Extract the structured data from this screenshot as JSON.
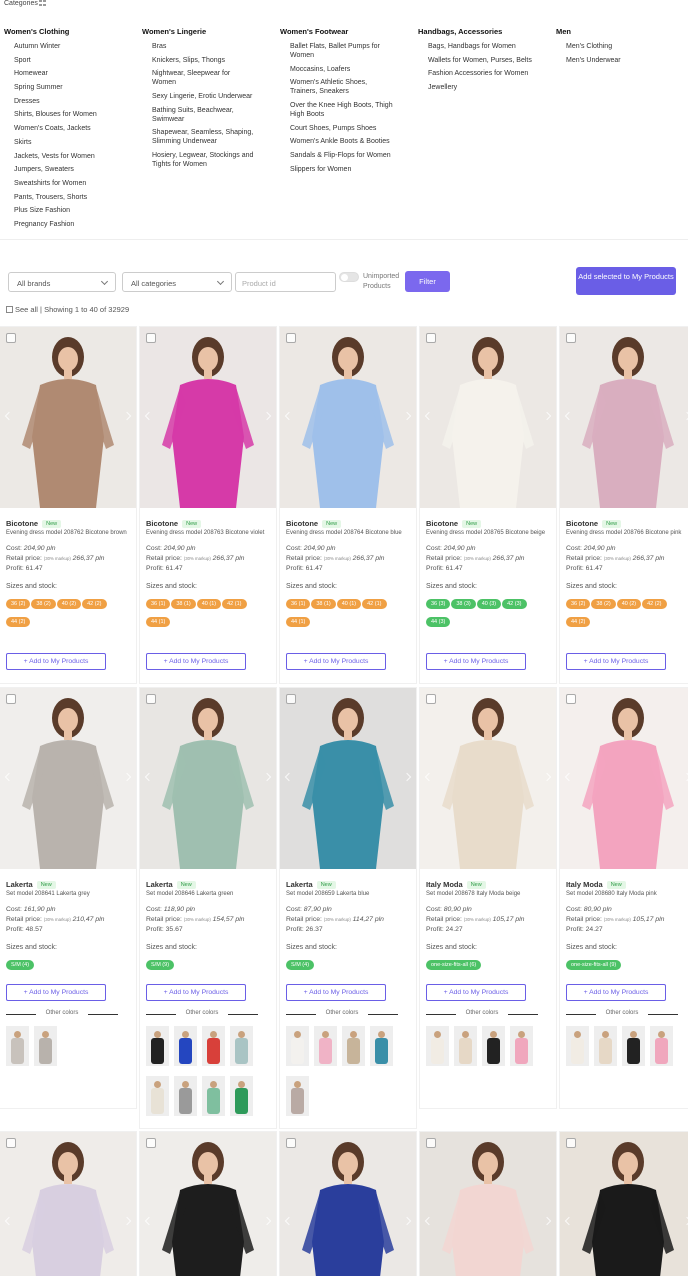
{
  "categories_label": "Categories",
  "mega_menu": [
    {
      "title": "Women's Clothing",
      "items": [
        "Autumn Winter",
        "Sport",
        "Homewear",
        "Spring Summer",
        "Dresses",
        "Shirts, Blouses for Women",
        "Women's Coats, Jackets",
        "Skirts",
        "Jackets, Vests for Women",
        "Jumpers, Sweaters",
        "Sweatshirts for Women",
        "Pants, Trousers, Shorts",
        "Plus Size Fashion",
        "Pregnancy Fashion"
      ]
    },
    {
      "title": "Women's Lingerie",
      "items": [
        "Bras",
        "Knickers, Slips, Thongs",
        "Nightwear, Sleepwear for Women",
        "Sexy Lingerie, Erotic Underwear",
        "Bathing Suits, Beachwear, Swimwear",
        "Shapewear, Seamless, Shaping, Slimming Underwear",
        "Hosiery, Legwear, Stockings and Tights for Women"
      ]
    },
    {
      "title": "Women's Footwear",
      "items": [
        "Ballet Flats, Ballet Pumps for Women",
        "Moccasins, Loafers",
        "Women's Athletic Shoes, Trainers, Sneakers",
        "Over the Knee High Boots, Thigh High Boots",
        "Court Shoes, Pumps Shoes",
        "Women's Ankle Boots & Booties",
        "Sandals & Flip-Flops for Women",
        "Slippers for Women"
      ]
    },
    {
      "title": "Handbags, Accessories",
      "items": [
        "Bags, Handbags for Women",
        "Wallets for Women, Purses, Belts",
        "Fashion Accessories for Women",
        "Jewellery"
      ]
    },
    {
      "title": "Men",
      "items": [
        "Men's Clothing",
        "Men's Underwear"
      ]
    }
  ],
  "filters": {
    "brands": "All brands",
    "categories": "All categories",
    "product_id_placeholder": "Product id",
    "unimported_label": "Unimported Products",
    "filter_button": "Filter",
    "add_selected_button": "Add selected to My Products"
  },
  "listing": {
    "see_all": "See all",
    "showing": "| Showing 1 to 40 of 32929"
  },
  "labels": {
    "new": "New",
    "cost": "Cost:",
    "retail": "Retail price:",
    "markup": "(30% markup)",
    "profit": "Profit:",
    "sizes": "Sizes and stock:",
    "add": "+ Add to My Products",
    "other_colors": "Other colors"
  },
  "products": [
    {
      "brand": "Bicotone",
      "title": "Evening dress model 208762 Bicotone brown",
      "cost": "204,90 pln",
      "retail": "266,37 pln",
      "profit": "61.47",
      "sizes": [
        "36 (2)",
        "38 (2)",
        "40 (2)",
        "42 (2)",
        "44 (2)"
      ],
      "chip_color": "orange",
      "color": "#b08a72",
      "bg": "#ece9e5",
      "thumbs": []
    },
    {
      "brand": "Bicotone",
      "title": "Evening dress model 208763 Bicotone violet",
      "cost": "204,90 pln",
      "retail": "266,37 pln",
      "profit": "61.47",
      "sizes": [
        "36 (1)",
        "38 (1)",
        "40 (1)",
        "42 (1)",
        "44 (1)"
      ],
      "chip_color": "orange",
      "color": "#d63aa8",
      "bg": "#ebe6e5",
      "thumbs": []
    },
    {
      "brand": "Bicotone",
      "title": "Evening dress model 208764 Bicotone blue",
      "cost": "204,90 pln",
      "retail": "266,37 pln",
      "profit": "61.47",
      "sizes": [
        "36 (1)",
        "38 (1)",
        "40 (1)",
        "42 (1)",
        "44 (1)"
      ],
      "chip_color": "orange",
      "color": "#9fc0ea",
      "bg": "#ece8e4",
      "thumbs": []
    },
    {
      "brand": "Bicotone",
      "title": "Evening dress model 208765 Bicotone beige",
      "cost": "204,90 pln",
      "retail": "266,37 pln",
      "profit": "61.47",
      "sizes": [
        "36 (3)",
        "38 (3)",
        "40 (3)",
        "42 (3)",
        "44 (3)"
      ],
      "chip_color": "green",
      "color": "#f5f2ec",
      "bg": "#ece8e4",
      "thumbs": []
    },
    {
      "brand": "Bicotone",
      "title": "Evening dress model 208766 Bicotone pink",
      "cost": "204,90 pln",
      "retail": "266,37 pln",
      "profit": "61.47",
      "sizes": [
        "36 (2)",
        "38 (2)",
        "40 (2)",
        "42 (2)",
        "44 (2)"
      ],
      "chip_color": "orange",
      "color": "#d9aebf",
      "bg": "#ece8e5",
      "thumbs": []
    },
    {
      "brand": "Lakerta",
      "title": "Set model 208641 Lakerta grey",
      "cost": "161,90 pln",
      "retail": "210,47 pln",
      "profit": "48.57",
      "sizes": [
        "S/M (4)"
      ],
      "chip_color": "green",
      "color": "#b9b3ad",
      "bg": "#f0eeec",
      "thumbs": [
        "#c8c2bc",
        "#b8b2ac"
      ]
    },
    {
      "brand": "Lakerta",
      "title": "Set model 208646 Lakerta green",
      "cost": "118,90 pln",
      "retail": "154,57 pln",
      "profit": "35.67",
      "sizes": [
        "S/M (9)"
      ],
      "chip_color": "green",
      "color": "#9fbfb0",
      "bg": "#e8e6e3",
      "thumbs": [
        "#222",
        "#2446c0",
        "#d8403a",
        "#a9c4c4",
        "#e8e2d6",
        "#9a9a9a",
        "#7fbf9f",
        "#2e9a5a"
      ]
    },
    {
      "brand": "Lakerta",
      "title": "Set model 208659 Lakerta blue",
      "cost": "87,90 pln",
      "retail": "114,27 pln",
      "profit": "26.37",
      "sizes": [
        "S/M (4)"
      ],
      "chip_color": "green",
      "color": "#3a8fa8",
      "bg": "#dfdedd",
      "thumbs": [
        "#f3f1ee",
        "#f0b3c6",
        "#c7b49a",
        "#3a8fa8",
        "#b9aaa4"
      ]
    },
    {
      "brand": "Italy Moda",
      "title": "Set model 208678 Italy Moda beige",
      "cost": "80,90 pln",
      "retail": "105,17 pln",
      "profit": "24.27",
      "sizes": [
        "one-size-fits-all (6)"
      ],
      "chip_color": "green",
      "color": "#e8dccb",
      "bg": "#f3f0ec",
      "thumbs": [
        "#f1ece4",
        "#e6d8c6",
        "#222",
        "#f0a7bd"
      ]
    },
    {
      "brand": "Italy Moda",
      "title": "Set model 208680 Italy Moda pink",
      "cost": "80,90 pln",
      "retail": "105,17 pln",
      "profit": "24.27",
      "sizes": [
        "one-size-fits-all (9)"
      ],
      "chip_color": "green",
      "color": "#f3a4bf",
      "bg": "#f4efed",
      "thumbs": [
        "#f1ece4",
        "#e6d8c6",
        "#222",
        "#f0a7bd"
      ]
    },
    {
      "brand": "",
      "title": "",
      "cost": "",
      "retail": "",
      "profit": "",
      "sizes": [],
      "chip_color": "green",
      "color": "#d8cfe0",
      "bg": "#efece9",
      "thumbs": []
    },
    {
      "brand": "",
      "title": "",
      "cost": "",
      "retail": "",
      "profit": "",
      "sizes": [],
      "chip_color": "green",
      "color": "#1d1d1d",
      "bg": "#efedea",
      "thumbs": []
    },
    {
      "brand": "",
      "title": "",
      "cost": "",
      "retail": "",
      "profit": "",
      "sizes": [],
      "chip_color": "green",
      "color": "#2a3e9c",
      "bg": "#ebe8e5",
      "thumbs": []
    },
    {
      "brand": "",
      "title": "",
      "cost": "",
      "retail": "",
      "profit": "",
      "sizes": [],
      "chip_color": "green",
      "color": "#f2d6d2",
      "bg": "#e6e2dd",
      "thumbs": []
    },
    {
      "brand": "",
      "title": "",
      "cost": "",
      "retail": "",
      "profit": "",
      "sizes": [],
      "chip_color": "green",
      "color": "#1a1a1a",
      "bg": "#e8e2da",
      "thumbs": []
    }
  ]
}
